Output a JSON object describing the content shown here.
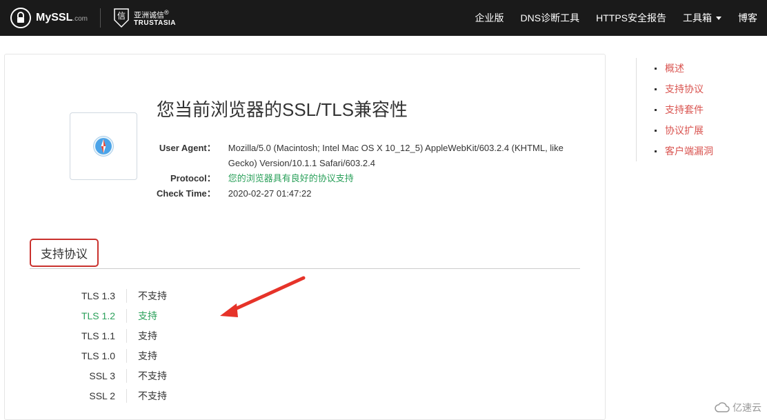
{
  "nav": {
    "logo1_main": "MySSL",
    "logo1_sub": ".com",
    "logo2_line1": "亚洲诚信",
    "logo2_line2": "TRUSTASIA",
    "logo2_badge": "信",
    "logo2_r": "®",
    "links": {
      "enterprise": "企业版",
      "dns": "DNS诊断工具",
      "https": "HTTPS安全报告",
      "toolbox": "工具箱",
      "blog": "博客"
    }
  },
  "main": {
    "title": "您当前浏览器的SSL/TLS兼容性",
    "labels": {
      "ua": "User Agent：",
      "protocol": "Protocol：",
      "checktime": "Check Time："
    },
    "values": {
      "ua": "Mozilla/5.0 (Macintosh; Intel Mac OS X 10_12_5) AppleWebKit/603.2.4 (KHTML, like Gecko) Version/10.1.1 Safari/603.2.4",
      "protocol": "您的浏览器具有良好的协议支持",
      "checktime": "2020-02-27 01:47:22"
    }
  },
  "section": {
    "title": "支持协议",
    "rows": [
      {
        "name": "TLS 1.3",
        "status": "不支持",
        "highlight": false
      },
      {
        "name": "TLS 1.2",
        "status": "支持",
        "highlight": true
      },
      {
        "name": "TLS 1.1",
        "status": "支持",
        "highlight": false
      },
      {
        "name": "TLS 1.0",
        "status": "支持",
        "highlight": false
      },
      {
        "name": "SSL 3",
        "status": "不支持",
        "highlight": false
      },
      {
        "name": "SSL 2",
        "status": "不支持",
        "highlight": false
      }
    ]
  },
  "sidebar": {
    "items": [
      "概述",
      "支持协议",
      "支持套件",
      "协议扩展",
      "客户端漏洞"
    ]
  },
  "footer": {
    "brand": "亿速云"
  }
}
